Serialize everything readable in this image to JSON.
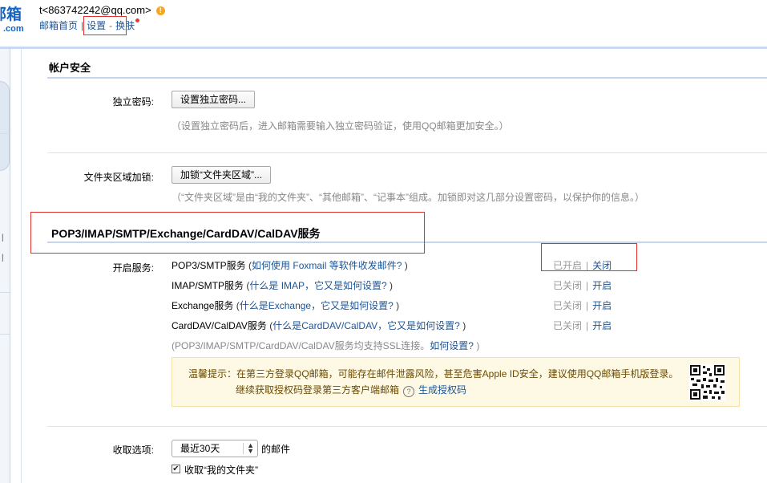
{
  "header": {
    "logo_text": "邮箱",
    "logo_sub": ".com",
    "email": "t<863742242@qq.com>",
    "warn_icon": "!",
    "nav": [
      "邮箱首页",
      "设置",
      "换肤"
    ],
    "nav_sep": "|",
    "nav_dash": "-"
  },
  "security": {
    "title": "帐户安全",
    "password_label": "独立密码:",
    "password_button": "设置独立密码...",
    "password_hint": "（设置独立密码后，进入邮箱需要输入独立密码验证，使用QQ邮箱更加安全。）",
    "folder_label": "文件夹区域加锁:",
    "folder_button": "加锁“文件夹区域”...",
    "folder_hint": "（“文件夹区域”是由“我的文件夹”、“其他邮箱”、“记事本”组成。加锁即对这几部分设置密码，以保护你的信息。）"
  },
  "pop": {
    "title": "POP3/IMAP/SMTP/Exchange/CardDAV/CalDAV服务",
    "open_label": "开启服务:",
    "services": [
      {
        "name": "POP3/SMTP服务",
        "paren_open": " (",
        "link": "如何使用 Foxmail 等软件收发邮件?",
        "paren_close": " )",
        "state": "已开启",
        "action": "关闭"
      },
      {
        "name": "IMAP/SMTP服务",
        "paren_open": " (",
        "link": "什么是 IMAP，它又是如何设置?",
        "paren_close": " )",
        "state": "已关闭",
        "action": "开启"
      },
      {
        "name": "Exchange服务",
        "paren_open": " (",
        "link": "什么是Exchange，它又是如何设置?",
        "paren_close": " )",
        "state": "已关闭",
        "action": "开启"
      },
      {
        "name": "CardDAV/CalDAV服务",
        "paren_open": " (",
        "link": "什么是CardDAV/CalDAV，它又是如何设置?",
        "paren_close": " )",
        "state": "已关闭",
        "action": "开启"
      }
    ],
    "ssl_note_prefix": "(POP3/IMAP/SMTP/CardDAV/CalDAV服务均支持SSL连接。",
    "ssl_note_link": "如何设置?",
    "ssl_note_suffix": " )",
    "tip_line1": "温馨提示：在第三方登录QQ邮箱，可能存在邮件泄露风险，甚至危害Apple ID安全，建议使用QQ邮箱手机版登录。",
    "tip_line2_prefix": "继续获取授权码登录第三方客户端邮箱",
    "tip_help": "?",
    "tip_link": "生成授权码"
  },
  "fetch": {
    "label": "收取选项:",
    "select_value": "最近30天",
    "suffix": "的邮件",
    "checkbox_label": "收取“我的文件夹”",
    "checked": true,
    "check_mark": "✔",
    "arrow_up": "▲",
    "arrow_down": "▼"
  },
  "colors": {
    "link": "#1e5494",
    "highlight_box": "#e0312f",
    "tip_bg": "#fdf9e4"
  }
}
